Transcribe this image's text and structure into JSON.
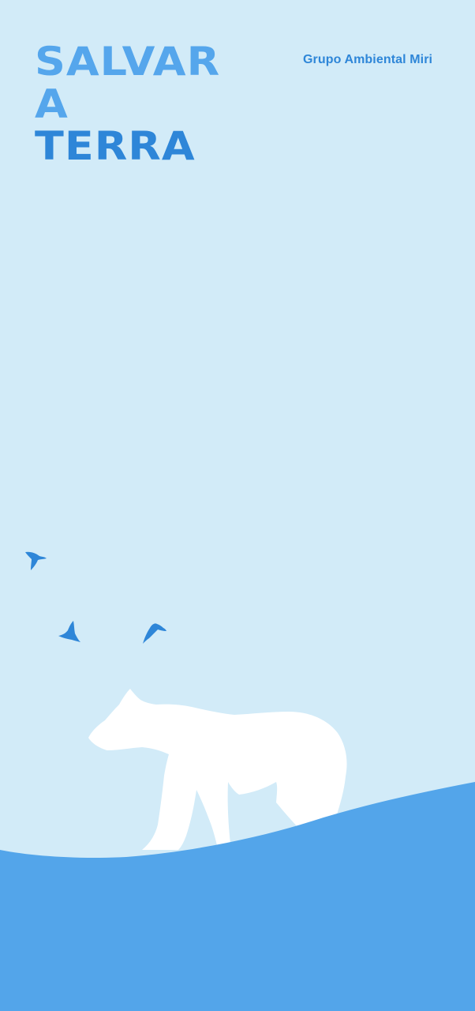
{
  "poster": {
    "title_lines": [
      "SALVAR",
      "A",
      "TERRA"
    ],
    "organization": "Grupo Ambiental Miri"
  },
  "colors": {
    "background": "#d2ebf8",
    "title_light": "#55a6ec",
    "title_dark": "#2e86d8",
    "ground": "#53a5ea",
    "bear": "#ffffff",
    "birds": "#2e86d8"
  },
  "illustration": {
    "icons": [
      "bird-icon",
      "bird-icon",
      "bird-icon",
      "polar-bear-icon"
    ]
  }
}
